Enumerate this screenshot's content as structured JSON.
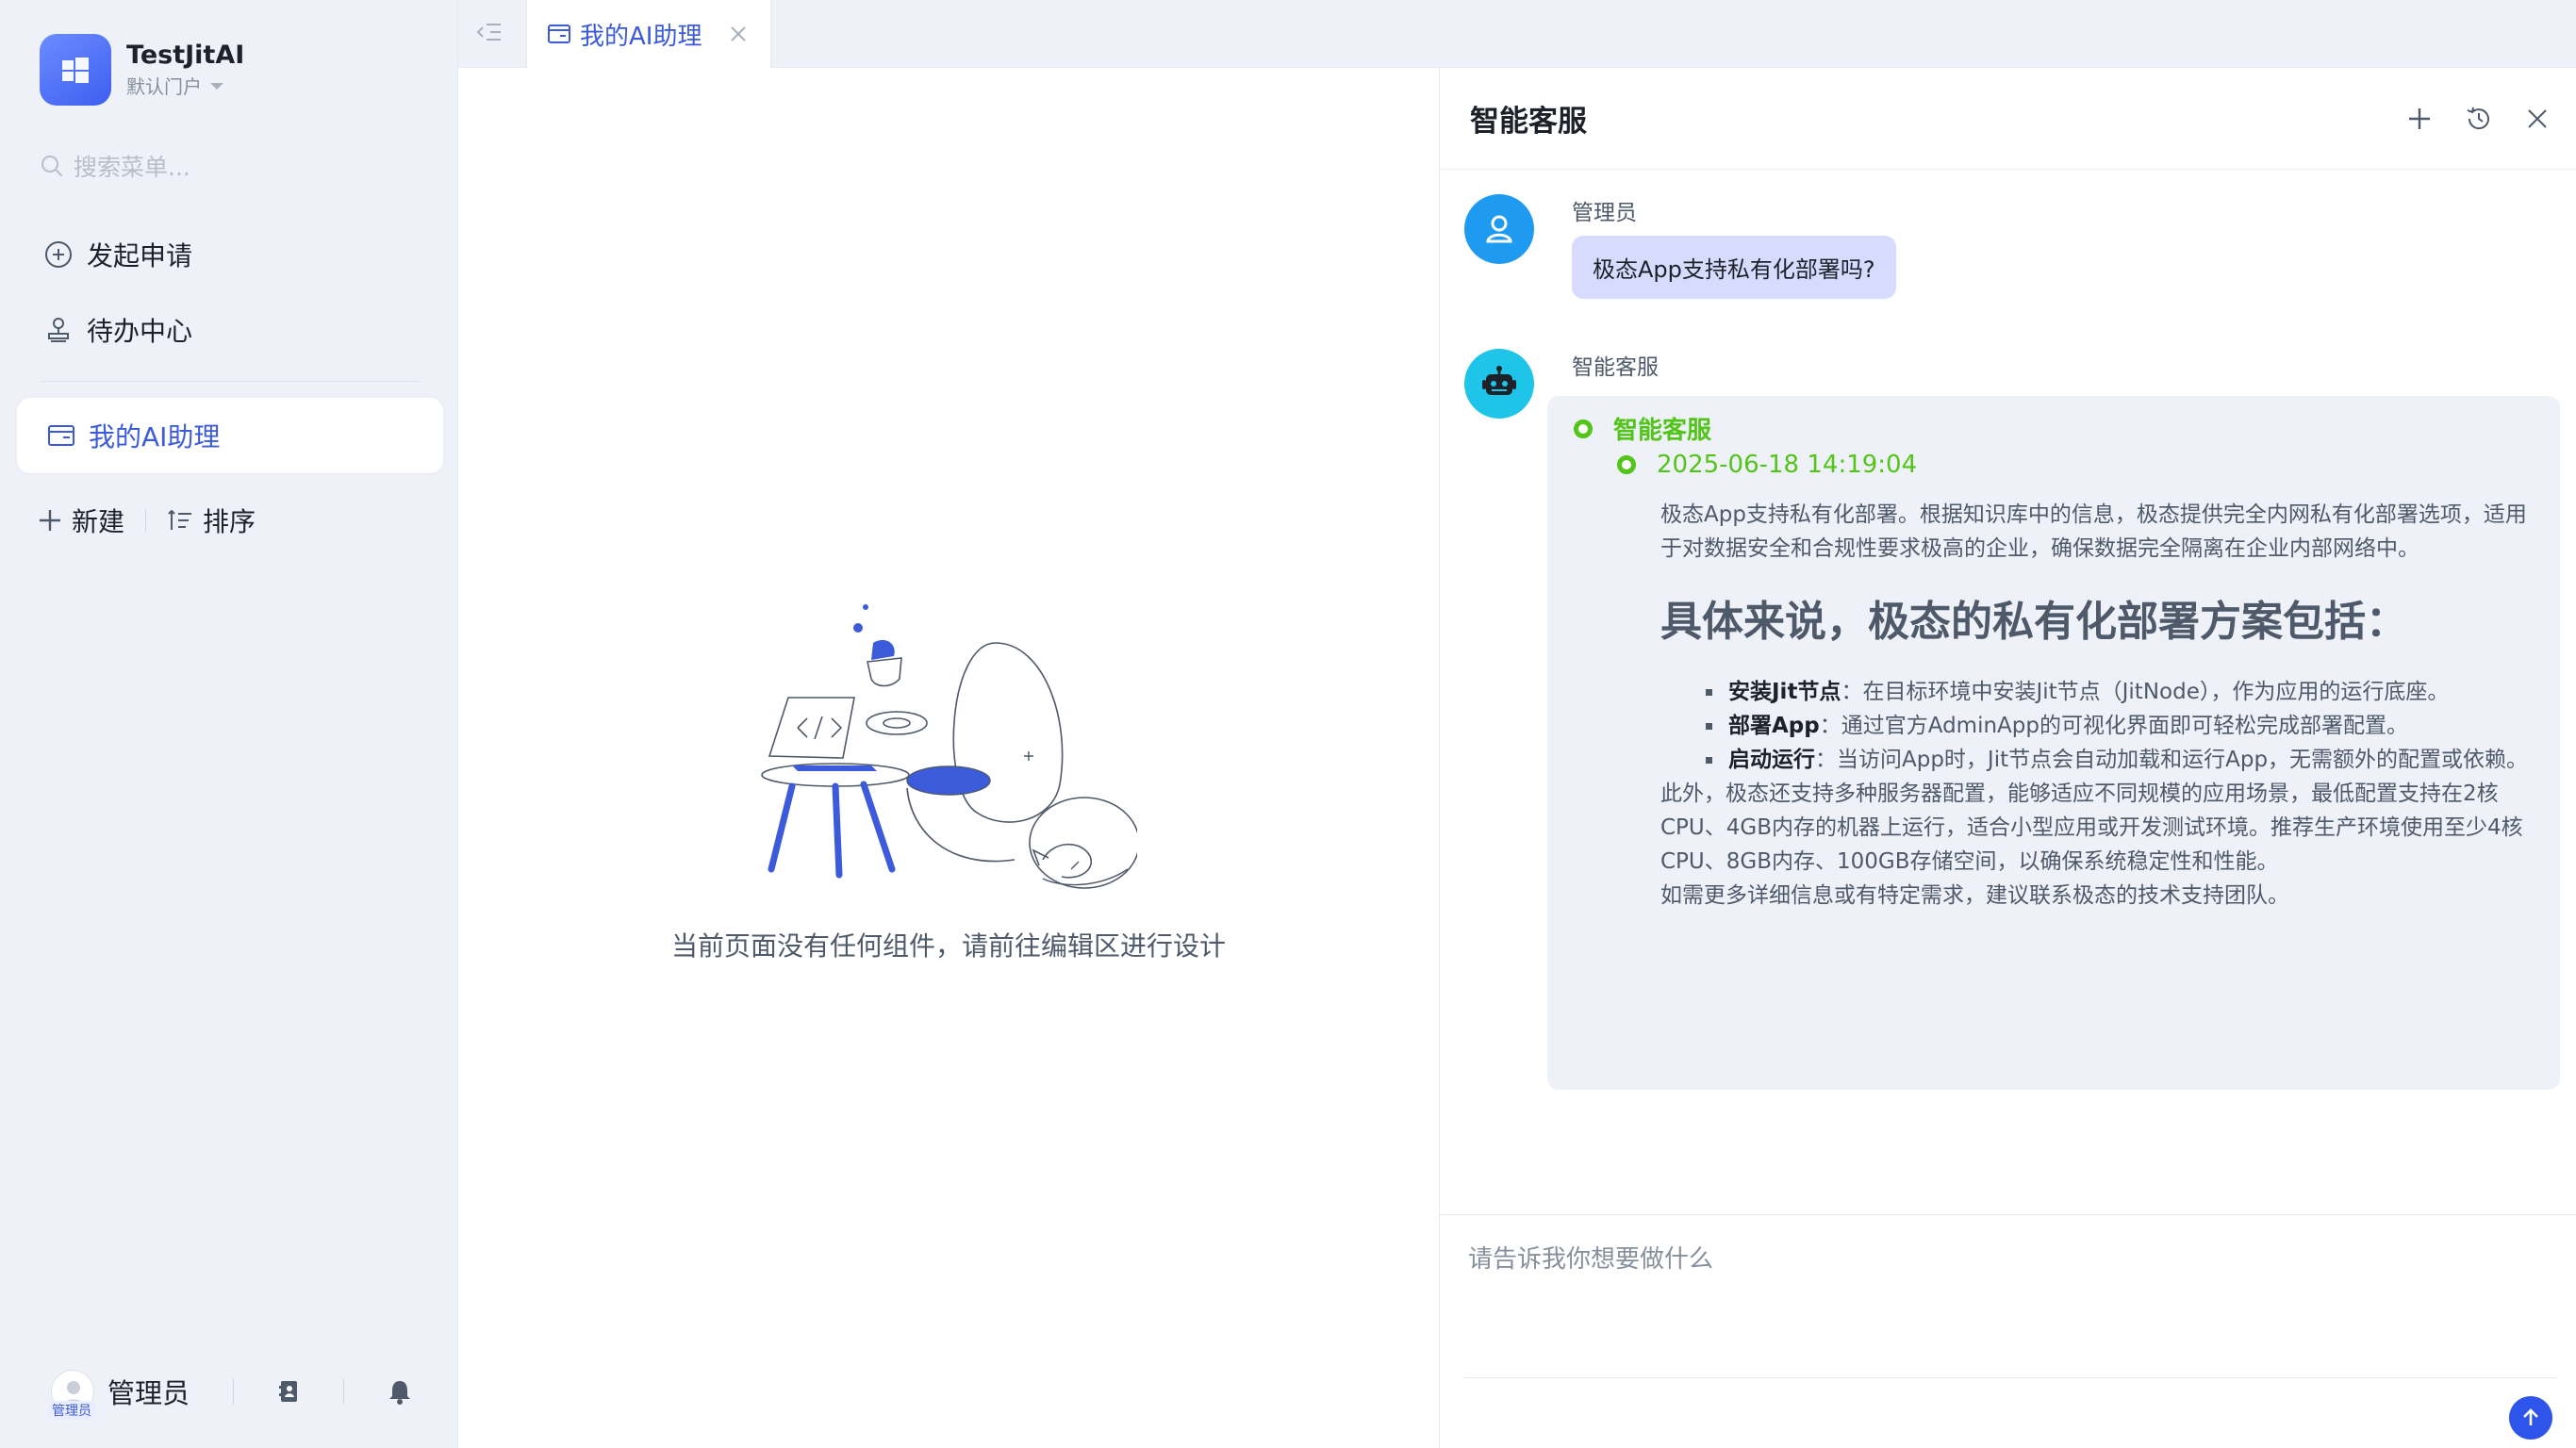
{
  "app": {
    "name": "TestJitAI",
    "portal": "默认门户",
    "accent": "#3b5bdb"
  },
  "sidebar": {
    "search_placeholder": "搜索菜单...",
    "items": [
      {
        "label": "发起申请",
        "icon": "plus-circle-icon"
      },
      {
        "label": "待办中心",
        "icon": "stamp-icon"
      }
    ],
    "active_item": {
      "label": "我的AI助理",
      "icon": "window-icon"
    },
    "actions": {
      "new_label": "新建",
      "sort_label": "排序"
    },
    "user": {
      "name": "管理员",
      "avatar_tag": "管理员"
    }
  },
  "tabs": [
    {
      "label": "我的AI助理",
      "active": true
    }
  ],
  "content": {
    "empty_text": "当前页面没有任何组件，请前往编辑区进行设计"
  },
  "chat": {
    "title": "智能客服",
    "messages": [
      {
        "sender": "管理员",
        "text": "极态App支持私有化部署吗?"
      },
      {
        "sender": "智能客服",
        "step_title": "智能客服",
        "timestamp": "2025-06-18 14:19:04",
        "intro": "极态App支持私有化部署。根据知识库中的信息，极态提供完全内网私有化部署选项，适用于对数据安全和合规性要求极高的企业，确保数据完全隔离在企业内部网络中。",
        "heading": "具体来说，极态的私有化部署方案包括：",
        "bullets": [
          {
            "bold": "安装Jit节点",
            "text": "：在目标环境中安装Jit节点（JitNode），作为应用的运行底座。"
          },
          {
            "bold": "部署App",
            "text": "：通过官方AdminApp的可视化界面即可轻松完成部署配置。"
          },
          {
            "bold": "启动运行",
            "text": "：当访问App时，Jit节点会自动加载和运行App，无需额外的配置或依赖。"
          }
        ],
        "paragraph": "此外，极态还支持多种服务器配置，能够适应不同规模的应用场景，最低配置支持在2核CPU、4GB内存的机器上运行，适合小型应用或开发测试环境。推荐生产环境使用至少4核CPU、8GB内存、100GB存储空间，以确保系统稳定性和性能。",
        "closing": "如需更多详细信息或有特定需求，建议联系极态的技术支持团队。"
      }
    ],
    "input_placeholder": "请告诉我你想要做什么",
    "colors": {
      "user_bubble": "#d7dcff",
      "step_green": "#52c41a",
      "bot_avatar": "#1ec5e8",
      "user_avatar": "#1e9bf0"
    }
  }
}
